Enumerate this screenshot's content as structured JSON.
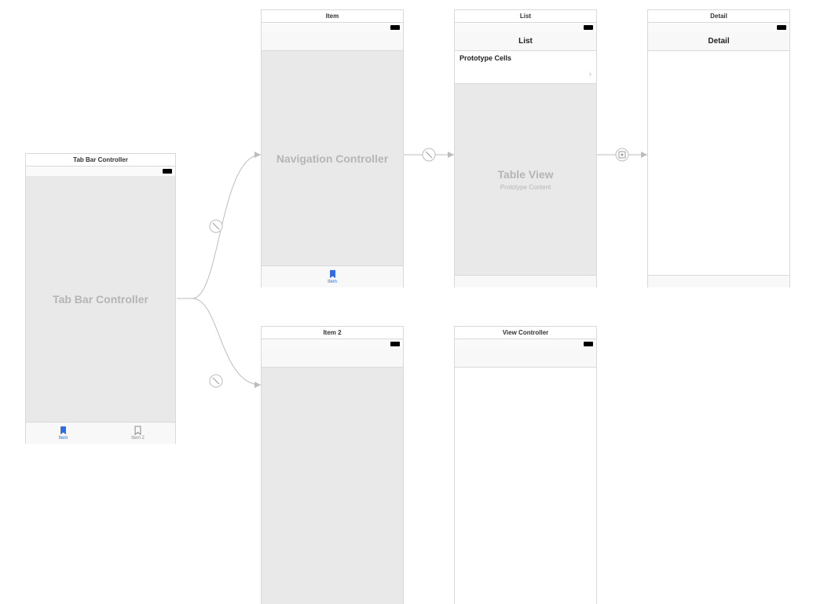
{
  "scenes": {
    "tabbar": {
      "title": "Tab Bar Controller",
      "placeholder": "Tab Bar Controller",
      "tabs": [
        {
          "label": "Item",
          "selected": true
        },
        {
          "label": "Item 2",
          "selected": false
        }
      ]
    },
    "item": {
      "title": "Item",
      "placeholder": "Navigation Controller",
      "tab_label": "Item"
    },
    "list": {
      "title": "List",
      "nav_title": "List",
      "prototype_header": "Prototype Cells",
      "table_placeholder_title": "Table View",
      "table_placeholder_sub": "Prototype Content"
    },
    "detail": {
      "title": "Detail",
      "nav_title": "Detail"
    },
    "item2": {
      "title": "Item 2"
    },
    "viewcontroller": {
      "title": "View Controller"
    }
  }
}
